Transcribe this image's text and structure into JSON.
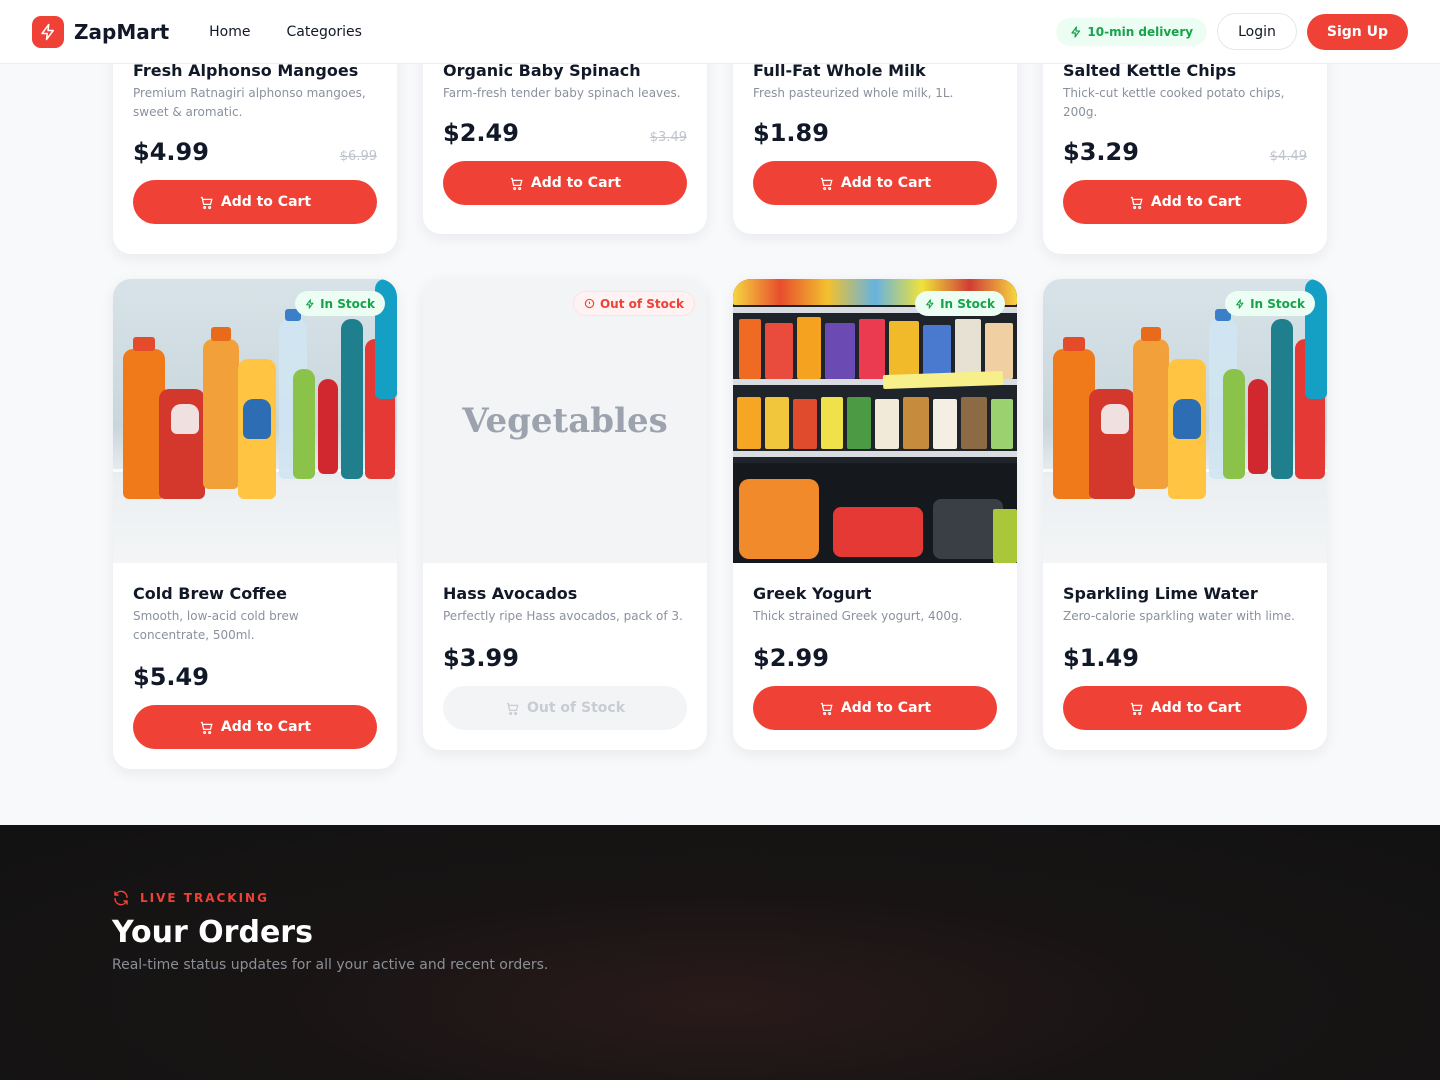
{
  "nav": {
    "brand": "ZapMart",
    "links": [
      "Home",
      "Categories"
    ],
    "delivery_badge": "10-min delivery",
    "login": "Login",
    "signup": "Sign Up"
  },
  "products_top": [
    {
      "title": "Fresh Alphonso Mangoes",
      "desc": "Premium Ratnagiri alphonso mangoes, sweet & aromatic.",
      "price": "$4.99",
      "old_price": "$6.99",
      "cta": "Add to Cart"
    },
    {
      "title": "Organic Baby Spinach",
      "desc": "Farm-fresh tender baby spinach leaves.",
      "price": "$2.49",
      "old_price": "$3.49",
      "cta": "Add to Cart"
    },
    {
      "title": "Full-Fat Whole Milk",
      "desc": "Fresh pasteurized whole milk, 1L.",
      "price": "$1.89",
      "old_price": "",
      "cta": "Add to Cart"
    },
    {
      "title": "Salted Kettle Chips",
      "desc": "Thick-cut kettle cooked potato chips, 200g.",
      "price": "$3.29",
      "old_price": "$4.49",
      "cta": "Add to Cart"
    }
  ],
  "products": [
    {
      "title": "Cold Brew Coffee",
      "desc": "Smooth, low-acid cold brew concentrate, 500ml.",
      "price": "$5.49",
      "badge": "In Stock",
      "cta": "Add to Cart",
      "image": "drinks-shelf"
    },
    {
      "title": "Hass Avocados",
      "desc": "Perfectly ripe Hass avocados, pack of 3.",
      "price": "$3.99",
      "badge": "Out of Stock",
      "cta": "Out of Stock",
      "placeholder": "Vegetables"
    },
    {
      "title": "Greek Yogurt",
      "desc": "Thick strained Greek yogurt, 400g.",
      "price": "$2.99",
      "badge": "In Stock",
      "cta": "Add to Cart",
      "image": "store-shelves"
    },
    {
      "title": "Sparkling Lime Water",
      "desc": "Zero-calorie sparkling water with lime.",
      "price": "$1.49",
      "badge": "In Stock",
      "cta": "Add to Cart",
      "image": "drinks-shelf"
    }
  ],
  "orders": {
    "eyebrow": "LIVE TRACKING",
    "title": "Your Orders",
    "subtitle": "Real-time status updates for all your active and recent orders."
  },
  "colors": {
    "accent": "#ef4136",
    "success": "#16a34a",
    "dark": "#121212"
  }
}
